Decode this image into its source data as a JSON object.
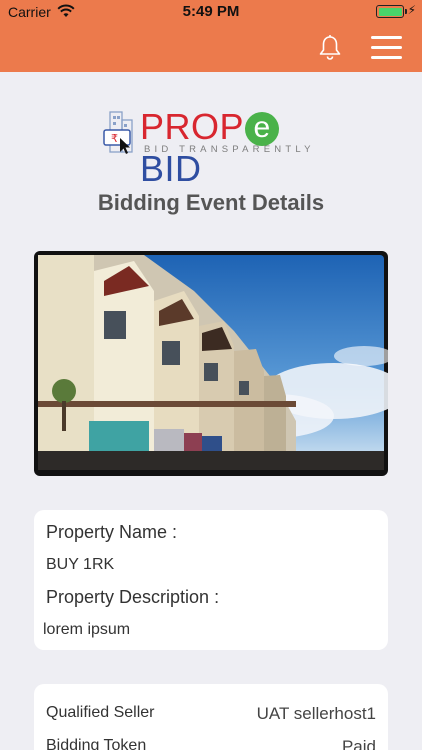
{
  "status_bar": {
    "carrier": "Carrier",
    "time": "5:49 PM"
  },
  "header": {
    "bell_icon": "bell-icon",
    "menu_icon": "hamburger-menu-icon"
  },
  "logo": {
    "prop": "PROP",
    "e": "e",
    "bid": "BID",
    "tagline": "BID TRANSPARENTLY"
  },
  "page": {
    "title": "Bidding Event Details"
  },
  "carousel": {
    "slides": 2,
    "active_index": 0
  },
  "property": {
    "name_label": "Property Name :",
    "name_value": "BUY 1RK",
    "description_label": "Property Description :",
    "description_value": "lorem ipsum"
  },
  "details": {
    "rows": [
      {
        "label": "Qualified Seller",
        "value": "UAT sellerhost1"
      },
      {
        "label": "Bidding Token",
        "value": "Paid"
      }
    ]
  },
  "colors": {
    "header_bg": "#ec7a4c",
    "page_bg": "#eeeef3",
    "battery": "#48d36a"
  }
}
